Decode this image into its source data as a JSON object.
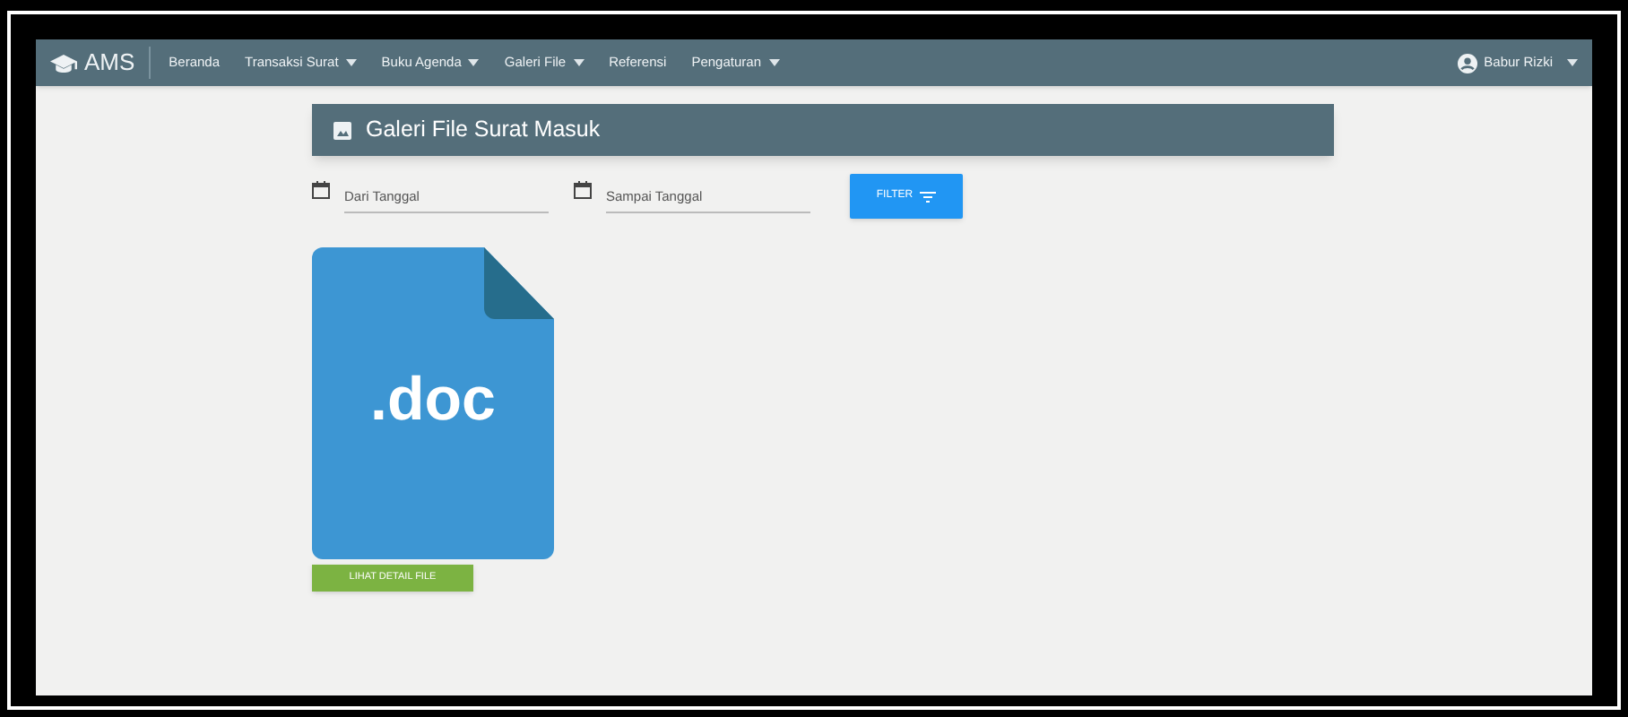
{
  "navbar": {
    "brand": "AMS",
    "menu": [
      {
        "label": "Beranda",
        "dropdown": false
      },
      {
        "label": "Transaksi Surat",
        "dropdown": true
      },
      {
        "label": "Buku Agenda",
        "dropdown": true
      },
      {
        "label": "Galeri File",
        "dropdown": true
      },
      {
        "label": "Referensi",
        "dropdown": false
      },
      {
        "label": "Pengaturan",
        "dropdown": true
      }
    ],
    "user": "Babur Rizki"
  },
  "panel": {
    "title": "Galeri File Surat Masuk"
  },
  "filters": [
    {
      "placeholder": "Dari Tanggal"
    },
    {
      "placeholder": "Sampai Tanggal"
    }
  ],
  "filter_button": "FILTER",
  "files": [
    {
      "extension": ".doc",
      "button": "LIHAT DETAIL FILE"
    }
  ]
}
